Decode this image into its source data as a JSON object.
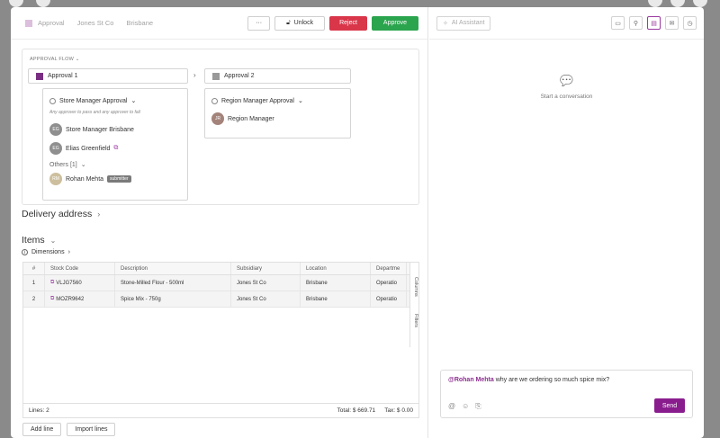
{
  "header": {
    "crumbs": [
      "Approval",
      "Jones St Co",
      "Brisbane"
    ],
    "more_label": "···",
    "unlock_label": "Unlock",
    "reject_label": "Reject",
    "approve_label": "Approve"
  },
  "approval_flow": {
    "title": "APPROVAL FLOW",
    "stage1": {
      "name": "Approval 1",
      "color": "#7a2e83",
      "group": "Store Manager Approval",
      "note": "Any approver to pass and any approver to fail",
      "approvers": [
        {
          "initials": "EG",
          "name": "Store Manager Brisbane"
        },
        {
          "initials": "EG",
          "name": "Elias Greenfield"
        }
      ],
      "others_label": "Others [1]",
      "submitter": {
        "initials": "RM",
        "name": "Rohan Mehta",
        "tag": "submitter"
      }
    },
    "stage2": {
      "name": "Approval 2",
      "color": "#999999",
      "group": "Region Manager Approval",
      "approver": {
        "initials": "JR",
        "name": "Region Manager"
      }
    }
  },
  "delivery": {
    "title": "Delivery address"
  },
  "items": {
    "title": "Items",
    "dimensions_label": "Dimensions",
    "columns": [
      "#",
      "Stock Code",
      "Description",
      "Subsidiary",
      "Location",
      "Departme"
    ],
    "rows": [
      {
        "n": "1",
        "code": "VLJG7560",
        "desc": "Stone-Milled Flour - 500ml",
        "sub": "Jones St Co",
        "loc": "Brisbane",
        "dept": "Operatio"
      },
      {
        "n": "2",
        "code": "MOZR9642",
        "desc": "Spice Mix - 750g",
        "sub": "Jones St Co",
        "loc": "Brisbane",
        "dept": "Operatio"
      }
    ],
    "side_tabs": [
      "Columns",
      "Filters"
    ],
    "lines_label": "Lines: 2",
    "total_label": "Total: $ 669.71",
    "tax_label": "Tax: $ 0.00",
    "add_line_label": "Add line",
    "import_lines_label": "Import lines"
  },
  "assistant": {
    "ai_label": "AI Assistant",
    "empty_label": "Start a conversation",
    "message_mention": "@Rohan Mehta",
    "message_text": " why are we ordering so much spice mix?",
    "send_label": "Send"
  },
  "colors": {
    "accent": "#8a1d8e",
    "reject": "#d9364a",
    "approve": "#2ba44e"
  }
}
